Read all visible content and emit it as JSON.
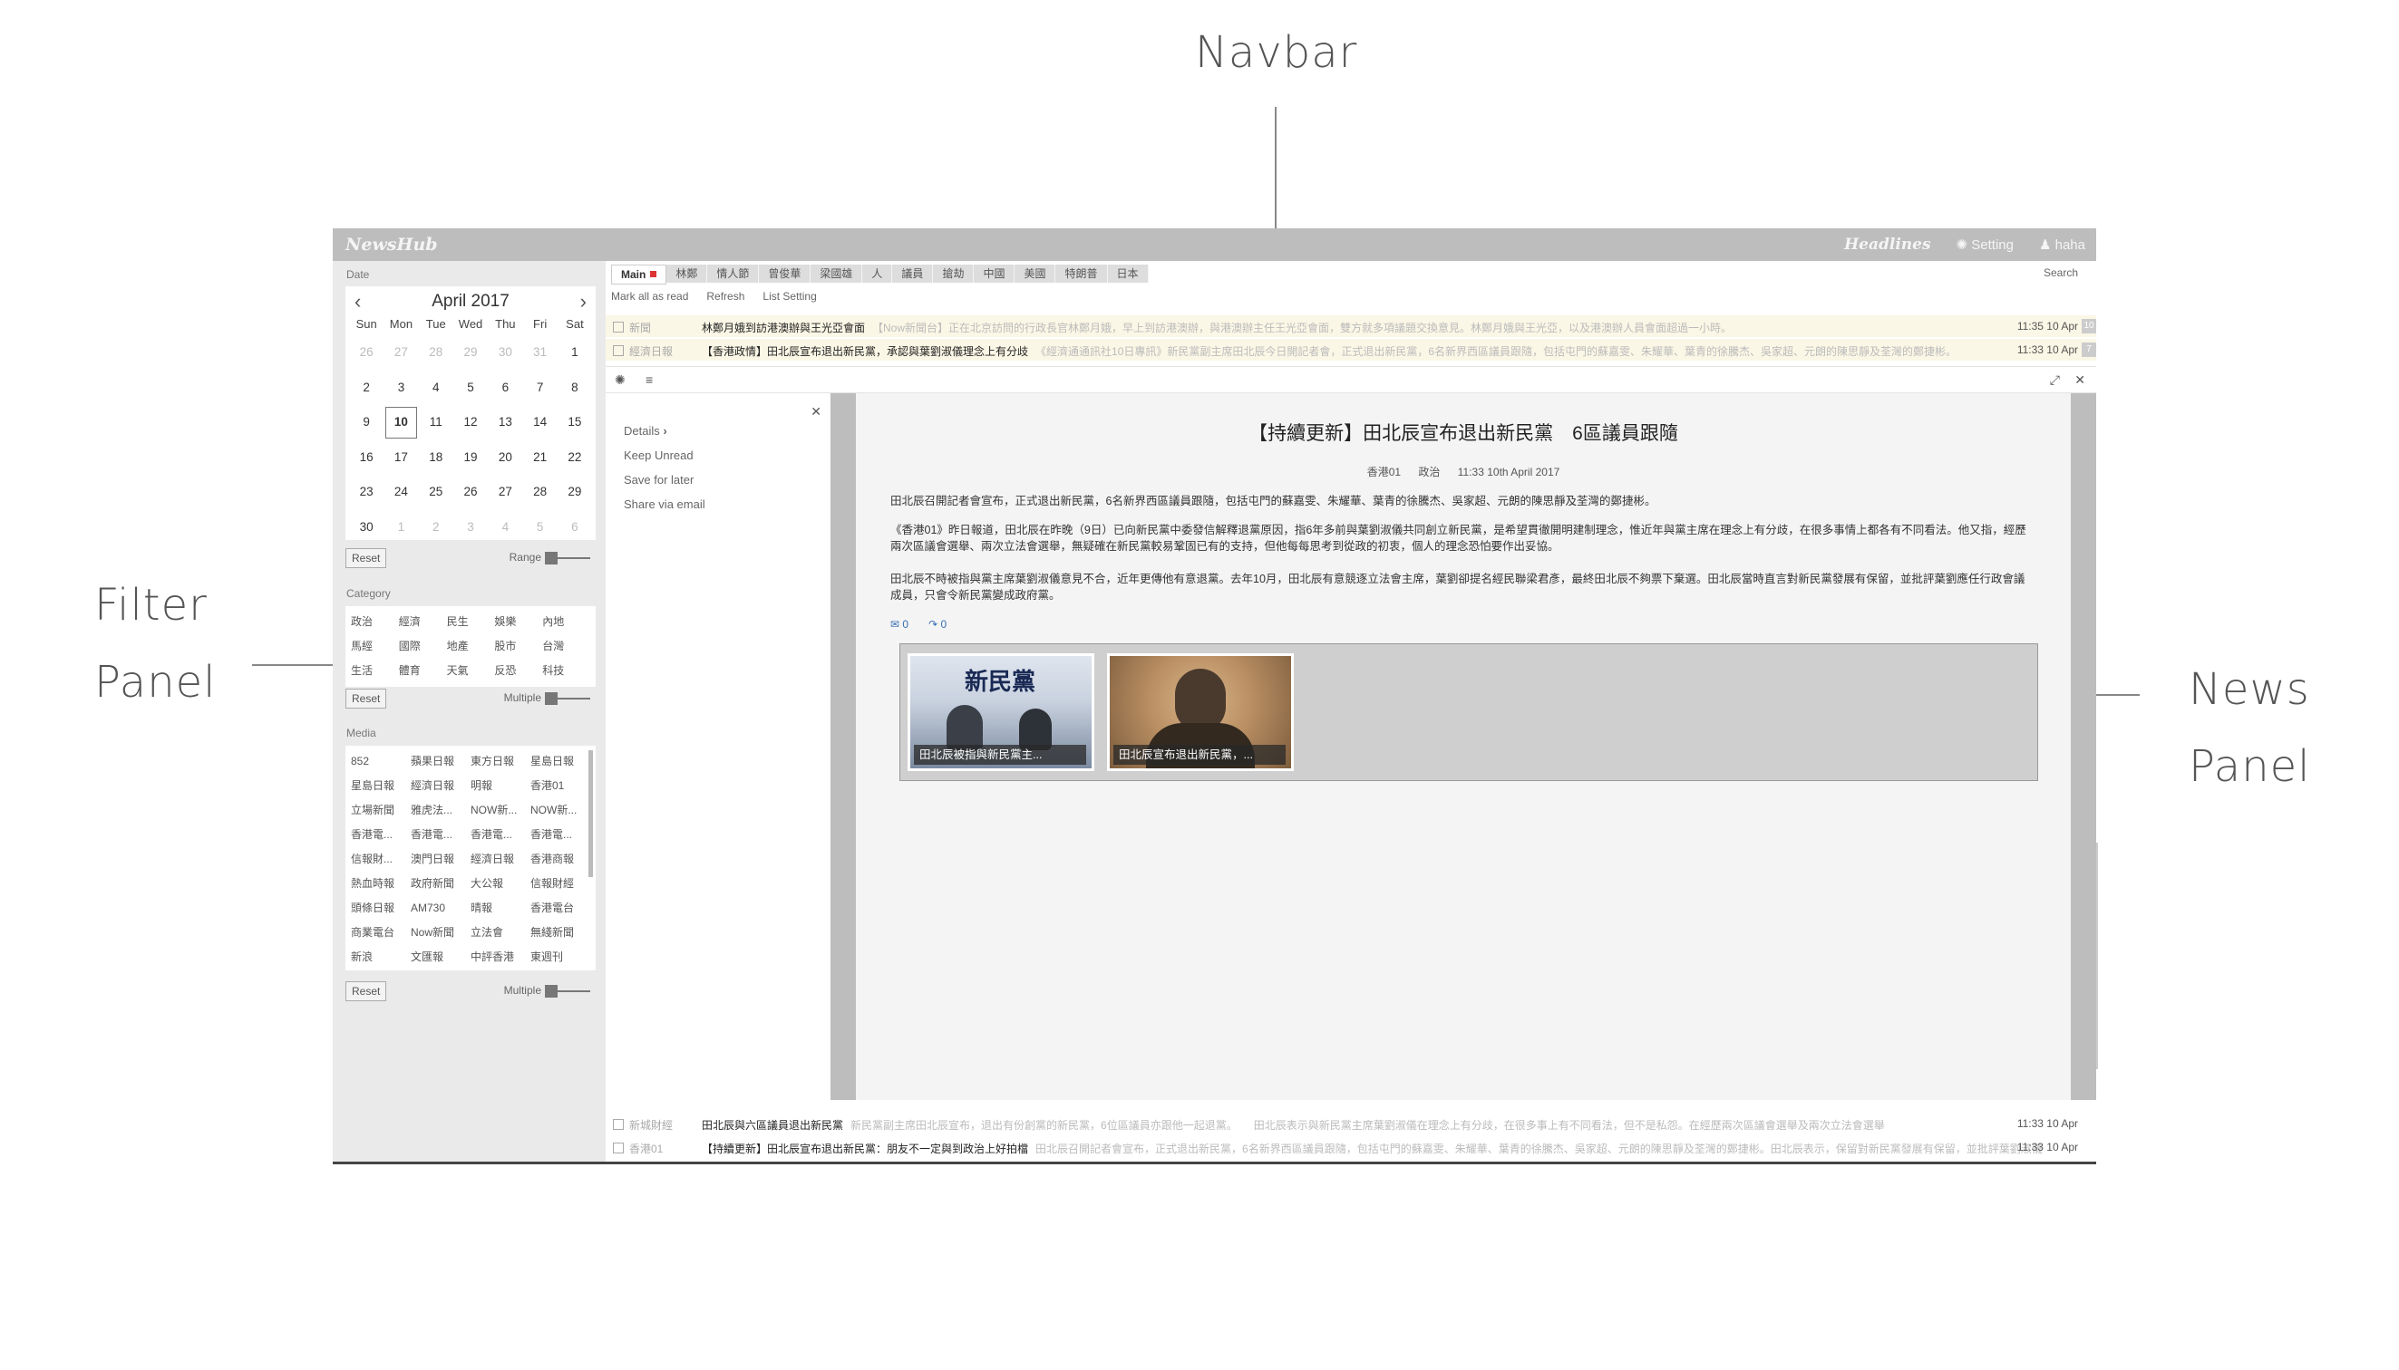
{
  "annotations": {
    "navbar": "Navbar",
    "filter_line1": "Filter",
    "filter_line2": "Panel",
    "news_line1": "News",
    "news_line2": "Panel"
  },
  "navbar": {
    "logo": "NewsHub",
    "headlines": "Headlines",
    "setting": "Setting",
    "user": "haha"
  },
  "filter": {
    "date_title": "Date",
    "calendar": {
      "month": "April",
      "year": "2017",
      "weekdays": [
        "Sun",
        "Mon",
        "Tue",
        "Wed",
        "Thu",
        "Fri",
        "Sat"
      ],
      "days": [
        [
          "26",
          "27",
          "28",
          "29",
          "30",
          "31",
          "1"
        ],
        [
          "2",
          "3",
          "4",
          "5",
          "6",
          "7",
          "8"
        ],
        [
          "9",
          "10",
          "11",
          "12",
          "13",
          "14",
          "15"
        ],
        [
          "16",
          "17",
          "18",
          "19",
          "20",
          "21",
          "22"
        ],
        [
          "23",
          "24",
          "25",
          "26",
          "27",
          "28",
          "29"
        ],
        [
          "30",
          "1",
          "2",
          "3",
          "4",
          "5",
          "6"
        ]
      ],
      "selected_day": "10"
    },
    "reset_label": "Reset",
    "range_label": "Range",
    "category_title": "Category",
    "categories": [
      "政治",
      "經濟",
      "民生",
      "娛樂",
      "內地",
      "馬經",
      "國際",
      "地產",
      "股市",
      "台灣",
      "生活",
      "體育",
      "天氣",
      "反恐",
      "科技"
    ],
    "multiple_label": "Multiple",
    "media_title": "Media",
    "media": [
      "852",
      "蘋果日報",
      "東方日報",
      "星島日報",
      "星島日報",
      "經濟日報",
      "明報",
      "香港01",
      "立場新聞",
      "雅虎法...",
      "NOW新...",
      "NOW新...",
      "香港電...",
      "香港電...",
      "香港電...",
      "香港電...",
      "信報財...",
      "澳門日報",
      "經濟日報",
      "香港商報",
      "熱血時報",
      "政府新聞",
      "大公報",
      "信報財經",
      "頭條日報",
      "AM730",
      "晴報",
      "香港電台",
      "商業電台",
      "Now新聞",
      "立法會",
      "無綫新聞",
      "新浪",
      "文匯報",
      "中評香港",
      "東週刊"
    ]
  },
  "content": {
    "tabs": [
      "Main",
      "林鄭",
      "情人節",
      "曾俊華",
      "梁國雄",
      "人",
      "議員",
      "搶劫",
      "中國",
      "美國",
      "特朗普",
      "日本"
    ],
    "search_placeholder": "Search",
    "actions": [
      "Mark all as read",
      "Refresh",
      "List Setting"
    ],
    "top_rows": [
      {
        "source": "新聞",
        "title": "林鄭月娥到訪港澳辦與王光亞會面",
        "snippet": "【Now新聞台】正在北京訪問的行政長官林鄭月娥，早上到訪港澳辦，與港澳辦主任王光亞會面，雙方就多項議題交換意見。林鄭月娥與王光亞，以及港澳辦人員會面超過一小時。",
        "time": "11:35 10 Apr",
        "badge": "10"
      },
      {
        "source": "經濟日報",
        "title": "【香港政情】田北辰宣布退出新民黨，承認與葉劉淑儀理念上有分歧",
        "snippet": "《經濟通通訊社10日專訊》新民黨副主席田北辰今日開記者會，正式退出新民黨，6名新界西區議員跟隨，包括屯門的蘇嘉雯、朱耀華、葉青的徐騰杰、吳家超、元朗的陳思靜及荃灣的鄭捷彬。",
        "time": "11:33 10 Apr",
        "badge": "7"
      }
    ],
    "bottom_rows": [
      {
        "source": "新城財經",
        "title": "田北辰與六區議員退出新民黨",
        "snippet": "新民黨副主席田北辰宣布，退出有份創黨的新民黨，6位區議員亦跟他一起退黨。　　田北辰表示與新民黨主席葉劉淑儀在理念上有分歧，在很多事上有不同看法，但不是私怨。在經歷兩次區議會選舉及兩次立法會選舉",
        "time": "11:33 10 Apr"
      },
      {
        "source": "香港01",
        "title": "【持續更新】田北辰宣布退出新民黨：朋友不一定與到政治上好拍檔",
        "snippet": "田北辰召開記者會宣布，正式退出新民黨，6名新界西區議員跟隨，包括屯門的蘇嘉雯、朱耀華、葉青的徐騰杰、吳家超、元朗的陳思靜及荃灣的鄭捷彬。田北辰表示，保留對新民黨發展有保留，並批評葉劉淑儀",
        "time": "11:33 10 Apr"
      }
    ],
    "article_menu": [
      "Details",
      "Keep Unread",
      "Save for later",
      "Share via email"
    ],
    "article": {
      "title": "【持續更新】田北辰宣布退出新民黨　6區議員跟隨",
      "source": "香港01",
      "category": "政治",
      "datetime": "11:33 10th April 2017",
      "paragraphs": [
        "田北辰召開記者會宣布，正式退出新民黨，6名新界西區議員跟隨，包括屯門的蘇嘉雯、朱耀華、葉青的徐騰杰、吳家超、元朗的陳思靜及荃灣的鄭捷彬。",
        "《香港01》昨日報道，田北辰在昨晚（9日）已向新民黨中委發信解釋退黨原因，指6年多前與葉劉淑儀共同創立新民黨，是希望貫徹開明建制理念，惟近年與黨主席在理念上有分歧，在很多事情上都各有不同看法。他又指，經歷兩次區議會選舉、兩次立法會選舉，無疑確在新民黨較易鞏固已有的支持，但他每每思考到從政的初衷，個人的理念恐怕要作出妥協。",
        "田北辰不時被指與黨主席葉劉淑儀意見不合，近年更傳他有意退黨。去年10月，田北辰有意競逐立法會主席，葉劉卻提名經民聯梁君彥，最終田北辰不夠票下棄選。田北辰當時直言對新民黨發展有保留，並批評葉劉應任行政會議成員，只會令新民黨變成政府黨。"
      ],
      "comments": "0",
      "shares": "0",
      "images": [
        {
          "caption": "田北辰被指與新民黨主..."
        },
        {
          "caption": "田北辰宣布退出新民黨，..."
        }
      ]
    }
  }
}
